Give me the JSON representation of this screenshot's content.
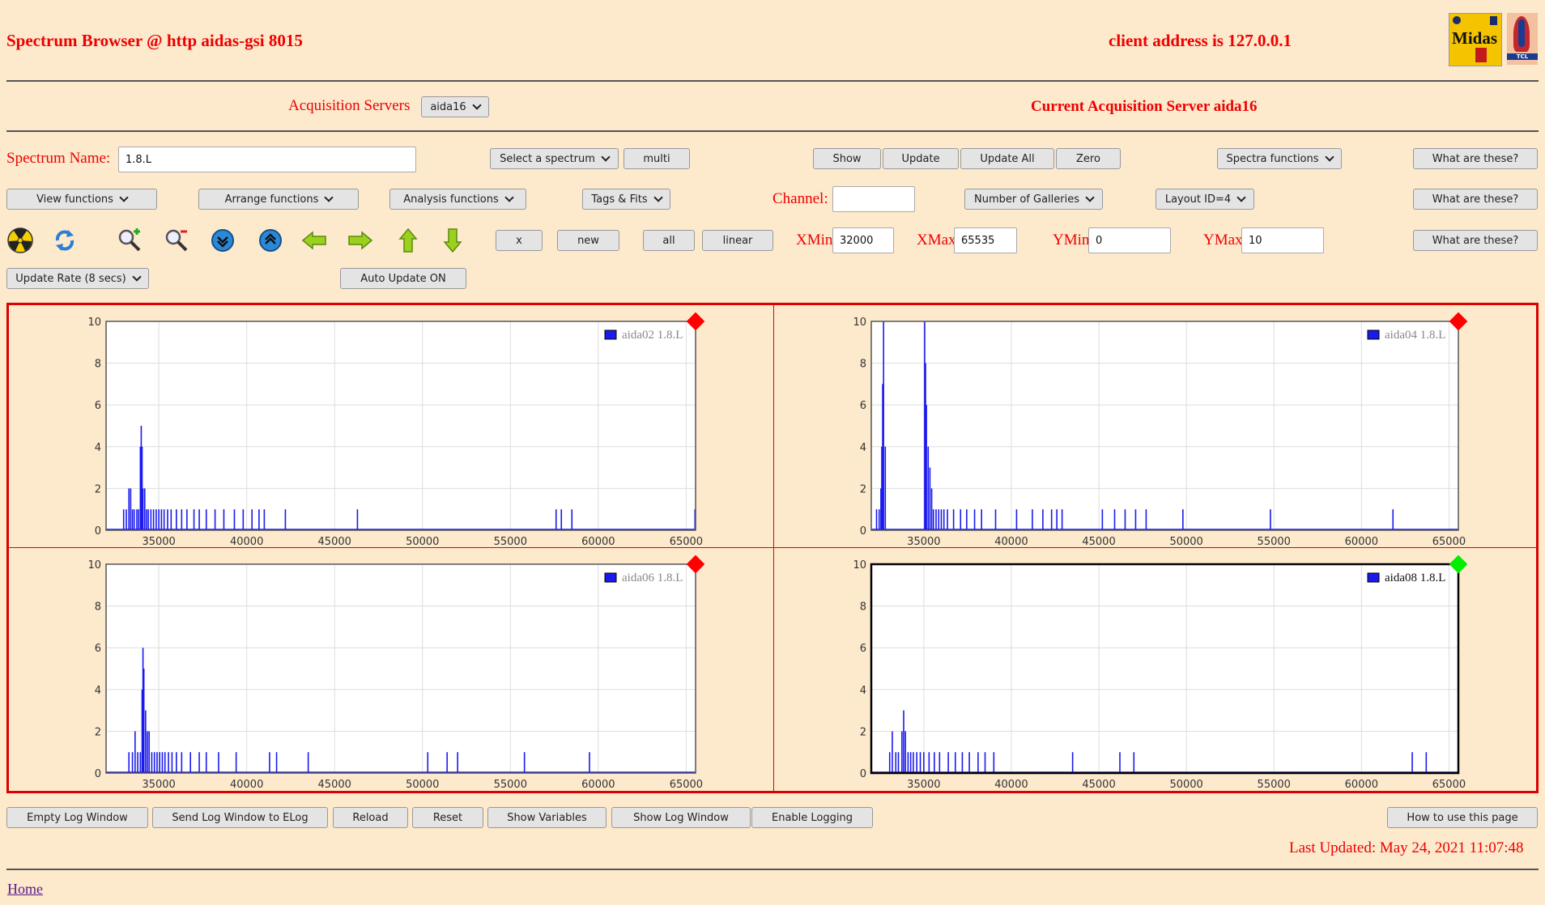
{
  "header": {
    "title": "Spectrum Browser @ http aidas-gsi 8015",
    "client": "client address is 127.0.0.1",
    "logo_midas": "Midas",
    "logo_tcl": "TCL"
  },
  "servers": {
    "label": "Acquisition Servers",
    "selected": "aida16",
    "current": "Current Acquisition Server aida16"
  },
  "row1": {
    "spectrum_label": "Spectrum Name:",
    "spectrum_value": "1.8.L",
    "select_spectrum": "Select a spectrum",
    "multi": "multi",
    "show": "Show",
    "update": "Update",
    "update_all": "Update All",
    "zero": "Zero",
    "spectra_functions": "Spectra functions",
    "what": "What are these?"
  },
  "row2": {
    "view": "View functions",
    "arrange": "Arrange functions",
    "analysis": "Analysis functions",
    "tags": "Tags & Fits",
    "channel_label": "Channel:",
    "channel_value": "",
    "galleries": "Number of Galleries",
    "layout": "Layout ID=4",
    "what": "What are these?"
  },
  "row3": {
    "x": "x",
    "new": "new",
    "all": "all",
    "linear": "linear",
    "xmin_label": "XMin",
    "xmin": "32000",
    "xmax_label": "XMax",
    "xmax": "65535",
    "ymin_label": "YMin",
    "ymin": "0",
    "ymax_label": "YMax",
    "ymax": "10",
    "what": "What are these?"
  },
  "row4": {
    "update_rate": "Update Rate (8 secs)",
    "auto_update": "Auto Update ON"
  },
  "icons": [
    "radiation-icon",
    "refresh-icon",
    "zoom-in-icon",
    "zoom-out-icon",
    "expand-down-icon",
    "expand-up-icon",
    "arrow-left-icon",
    "arrow-right-icon",
    "arrow-up-icon",
    "arrow-down-icon"
  ],
  "chart_data": [
    {
      "type": "line",
      "legend": "aida02 1.8.L",
      "status_color": "#ff0000",
      "active": false,
      "xlim": [
        32000,
        65535
      ],
      "ylim": [
        0,
        10
      ],
      "xticks": [
        35000,
        40000,
        45000,
        50000,
        55000,
        60000,
        65000
      ],
      "yticks": [
        0,
        2,
        4,
        6,
        8,
        10
      ],
      "spikes": [
        [
          33000,
          1
        ],
        [
          33150,
          1
        ],
        [
          33300,
          2
        ],
        [
          33400,
          2
        ],
        [
          33500,
          1
        ],
        [
          33600,
          1
        ],
        [
          33750,
          1
        ],
        [
          33850,
          1
        ],
        [
          33950,
          4
        ],
        [
          34000,
          5
        ],
        [
          34050,
          4
        ],
        [
          34100,
          2
        ],
        [
          34200,
          2
        ],
        [
          34300,
          1
        ],
        [
          34400,
          1
        ],
        [
          34550,
          1
        ],
        [
          34700,
          1
        ],
        [
          34850,
          1
        ],
        [
          35000,
          1
        ],
        [
          35150,
          1
        ],
        [
          35300,
          1
        ],
        [
          35500,
          1
        ],
        [
          35700,
          1
        ],
        [
          36000,
          1
        ],
        [
          36300,
          1
        ],
        [
          36600,
          1
        ],
        [
          37000,
          1
        ],
        [
          37300,
          1
        ],
        [
          37700,
          1
        ],
        [
          38200,
          1
        ],
        [
          38700,
          1
        ],
        [
          39300,
          1
        ],
        [
          39800,
          1
        ],
        [
          40300,
          1
        ],
        [
          40700,
          1
        ],
        [
          41000,
          1
        ],
        [
          42200,
          1
        ],
        [
          46300,
          1
        ],
        [
          57600,
          1
        ],
        [
          57900,
          1
        ],
        [
          58500,
          1
        ],
        [
          65500,
          1
        ]
      ]
    },
    {
      "type": "line",
      "legend": "aida04 1.8.L",
      "status_color": "#ff0000",
      "active": false,
      "xlim": [
        32000,
        65535
      ],
      "ylim": [
        0,
        10
      ],
      "xticks": [
        35000,
        40000,
        45000,
        50000,
        55000,
        60000,
        65000
      ],
      "yticks": [
        0,
        2,
        4,
        6,
        8,
        10
      ],
      "spikes": [
        [
          32300,
          1
        ],
        [
          32450,
          1
        ],
        [
          32550,
          2
        ],
        [
          32600,
          4
        ],
        [
          32650,
          7
        ],
        [
          32700,
          10
        ],
        [
          32800,
          4
        ],
        [
          35050,
          10
        ],
        [
          35100,
          8
        ],
        [
          35150,
          6
        ],
        [
          35250,
          4
        ],
        [
          35350,
          3
        ],
        [
          35450,
          2
        ],
        [
          35550,
          1
        ],
        [
          35700,
          1
        ],
        [
          35850,
          1
        ],
        [
          36000,
          1
        ],
        [
          36150,
          1
        ],
        [
          36350,
          1
        ],
        [
          36700,
          1
        ],
        [
          37100,
          1
        ],
        [
          37450,
          1
        ],
        [
          37900,
          1
        ],
        [
          38300,
          1
        ],
        [
          39100,
          1
        ],
        [
          40300,
          1
        ],
        [
          41200,
          1
        ],
        [
          41800,
          1
        ],
        [
          42300,
          1
        ],
        [
          42600,
          1
        ],
        [
          42900,
          1
        ],
        [
          45200,
          1
        ],
        [
          45900,
          1
        ],
        [
          46500,
          1
        ],
        [
          47100,
          1
        ],
        [
          47700,
          1
        ],
        [
          49800,
          1
        ],
        [
          54800,
          1
        ],
        [
          61800,
          1
        ]
      ]
    },
    {
      "type": "line",
      "legend": "aida06 1.8.L",
      "status_color": "#ff0000",
      "active": false,
      "xlim": [
        32000,
        65535
      ],
      "ylim": [
        0,
        10
      ],
      "xticks": [
        35000,
        40000,
        45000,
        50000,
        55000,
        60000,
        65000
      ],
      "yticks": [
        0,
        2,
        4,
        6,
        8,
        10
      ],
      "spikes": [
        [
          33300,
          1
        ],
        [
          33500,
          1
        ],
        [
          33650,
          2
        ],
        [
          33800,
          1
        ],
        [
          33950,
          1
        ],
        [
          34050,
          4
        ],
        [
          34100,
          6
        ],
        [
          34150,
          5
        ],
        [
          34250,
          3
        ],
        [
          34350,
          2
        ],
        [
          34450,
          2
        ],
        [
          34600,
          1
        ],
        [
          34750,
          1
        ],
        [
          34900,
          1
        ],
        [
          35050,
          1
        ],
        [
          35200,
          1
        ],
        [
          35350,
          1
        ],
        [
          35550,
          1
        ],
        [
          35750,
          1
        ],
        [
          36000,
          1
        ],
        [
          36300,
          1
        ],
        [
          36800,
          1
        ],
        [
          37300,
          1
        ],
        [
          37700,
          1
        ],
        [
          38400,
          1
        ],
        [
          39400,
          1
        ],
        [
          41300,
          1
        ],
        [
          41700,
          1
        ],
        [
          43500,
          1
        ],
        [
          50300,
          1
        ],
        [
          51400,
          1
        ],
        [
          52000,
          1
        ],
        [
          55800,
          1
        ],
        [
          59500,
          1
        ]
      ]
    },
    {
      "type": "line",
      "legend": "aida08 1.8.L",
      "status_color": "#00ee00",
      "active": true,
      "xlim": [
        32000,
        65535
      ],
      "ylim": [
        0,
        10
      ],
      "xticks": [
        35000,
        40000,
        45000,
        50000,
        55000,
        60000,
        65000
      ],
      "yticks": [
        0,
        2,
        4,
        6,
        8,
        10
      ],
      "spikes": [
        [
          33050,
          1
        ],
        [
          33200,
          2
        ],
        [
          33400,
          1
        ],
        [
          33550,
          1
        ],
        [
          33750,
          2
        ],
        [
          33850,
          3
        ],
        [
          33950,
          2
        ],
        [
          34100,
          1
        ],
        [
          34250,
          1
        ],
        [
          34400,
          1
        ],
        [
          34600,
          1
        ],
        [
          34800,
          1
        ],
        [
          35000,
          1
        ],
        [
          35300,
          1
        ],
        [
          35600,
          1
        ],
        [
          35900,
          1
        ],
        [
          36400,
          1
        ],
        [
          36800,
          1
        ],
        [
          37200,
          1
        ],
        [
          37600,
          1
        ],
        [
          38100,
          1
        ],
        [
          38500,
          1
        ],
        [
          39000,
          1
        ],
        [
          43500,
          1
        ],
        [
          46200,
          1
        ],
        [
          47000,
          1
        ],
        [
          62900,
          1
        ],
        [
          63700,
          1
        ]
      ]
    }
  ],
  "bottom": {
    "empty_log": "Empty Log Window",
    "send_log": "Send Log Window to ELog",
    "reload": "Reload",
    "reset": "Reset",
    "show_vars": "Show Variables",
    "show_log": "Show Log Window",
    "enable_logging": "Enable Logging",
    "how_to": "How to use this page",
    "last_updated": "Last Updated: May 24, 2021 11:07:48",
    "home": "Home"
  }
}
